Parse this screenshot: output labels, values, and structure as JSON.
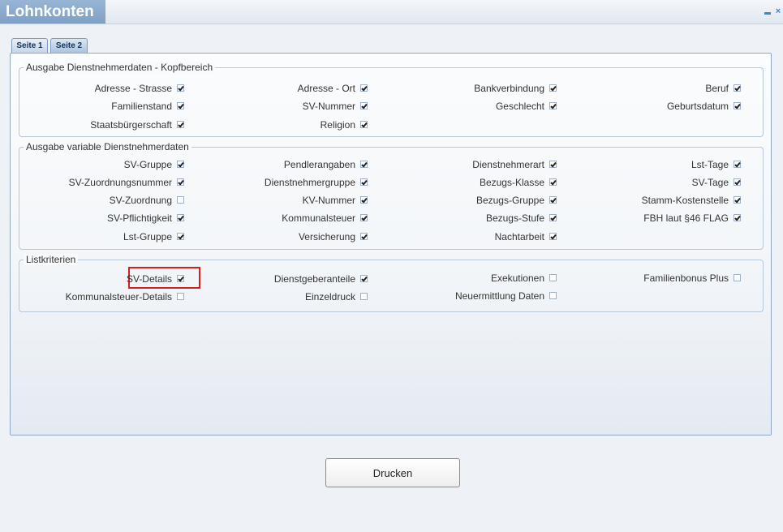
{
  "window": {
    "title": "Lohnkonten",
    "minimize_icon": "minimize-icon",
    "close_icon": "close-icon",
    "close_glyph": "×"
  },
  "tabs": [
    {
      "label": "Seite 1"
    },
    {
      "label": "Seite 2"
    }
  ],
  "groups": [
    {
      "title": "Ausgabe Dienstnehmerdaten - Kopfbereich",
      "items": [
        {
          "label": "Adresse - Strasse",
          "checked": true
        },
        {
          "label": "Adresse - Ort",
          "checked": true
        },
        {
          "label": "Bankverbindung",
          "checked": true
        },
        {
          "label": "Beruf",
          "checked": true
        },
        {
          "label": "Familienstand",
          "checked": true
        },
        {
          "label": "SV-Nummer",
          "checked": true
        },
        {
          "label": "Geschlecht",
          "checked": true
        },
        {
          "label": "Geburtsdatum",
          "checked": true
        },
        {
          "label": "Staatsbürgerschaft",
          "checked": true
        },
        {
          "label": "Religion",
          "checked": true
        }
      ]
    },
    {
      "title": "Ausgabe variable Dienstnehmerdaten",
      "items": [
        {
          "label": "SV-Gruppe",
          "checked": true
        },
        {
          "label": "Pendlerangaben",
          "checked": true
        },
        {
          "label": "Dienstnehmerart",
          "checked": true
        },
        {
          "label": "Lst-Tage",
          "checked": true
        },
        {
          "label": "SV-Zuordnungsnummer",
          "checked": true
        },
        {
          "label": "Dienstnehmergruppe",
          "checked": true
        },
        {
          "label": "Bezugs-Klasse",
          "checked": true
        },
        {
          "label": "SV-Tage",
          "checked": true
        },
        {
          "label": "SV-Zuordnung",
          "checked": false
        },
        {
          "label": "KV-Nummer",
          "checked": true
        },
        {
          "label": "Bezugs-Gruppe",
          "checked": true
        },
        {
          "label": "Stamm-Kostenstelle",
          "checked": true
        },
        {
          "label": "SV-Pflichtigkeit",
          "checked": true
        },
        {
          "label": "Kommunalsteuer",
          "checked": true
        },
        {
          "label": "Bezugs-Stufe",
          "checked": true
        },
        {
          "label": "FBH laut §46 FLAG",
          "checked": true
        },
        {
          "label": "Lst-Gruppe",
          "checked": true
        },
        {
          "label": "Versicherung",
          "checked": true
        },
        {
          "label": "Nachtarbeit",
          "checked": true
        }
      ]
    },
    {
      "title": "Listkriterien",
      "items": [
        {
          "label": "SV-Details",
          "checked": true
        },
        {
          "label": "Dienstgeberanteile",
          "checked": true
        },
        {
          "label": "Exekutionen",
          "checked": false
        },
        {
          "label": "Familienbonus Plus",
          "checked": false
        },
        {
          "label": "Kommunalsteuer-Details",
          "checked": false
        },
        {
          "label": "Einzeldruck",
          "checked": false
        },
        {
          "label": "Neuermittlung Daten",
          "checked": false
        }
      ]
    }
  ],
  "print_button": {
    "label": "Drucken"
  }
}
